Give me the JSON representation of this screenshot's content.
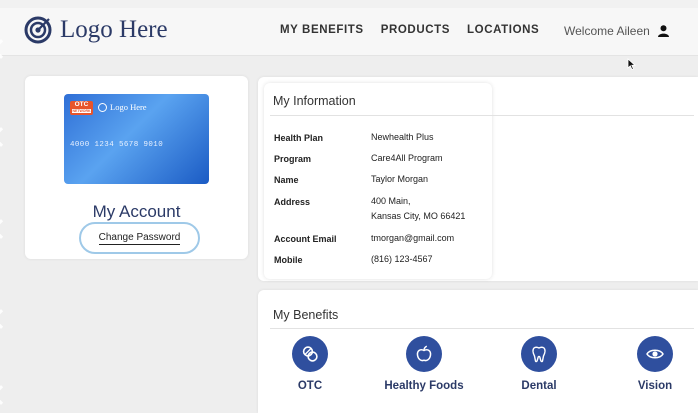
{
  "brand": {
    "logo_text": "Logo Here",
    "color": "#2b3a67",
    "accent": "#2f4f9e"
  },
  "nav": {
    "items": [
      {
        "label": "MY BENEFITS"
      },
      {
        "label": "PRODUCTS"
      },
      {
        "label": "LOCATIONS"
      }
    ]
  },
  "user": {
    "welcome": "Welcome Aileen",
    "icon": "user-icon"
  },
  "account": {
    "card": {
      "badge": "OTC",
      "badge_sub": "NETWORK",
      "logo_text": "Logo Here",
      "number": "4000 1234 5678 9010"
    },
    "title": "My Account",
    "change_password_label": "Change Password"
  },
  "info": {
    "title": "My Information",
    "rows": [
      {
        "label": "Health Plan",
        "value": "Newhealth Plus"
      },
      {
        "label": "Program",
        "value": "Care4All Program"
      },
      {
        "label": "Name",
        "value": "Taylor Morgan"
      },
      {
        "label": "Address",
        "value_line1": "400 Main,",
        "value_line2": "Kansas City, MO 66421"
      },
      {
        "label": "Account Email",
        "value": "tmorgan@gmail.com"
      },
      {
        "label": "Mobile",
        "value": "(816) 123-4567"
      }
    ]
  },
  "benefits": {
    "title": "My Benefits",
    "items": [
      {
        "label": "OTC",
        "icon": "pills-icon"
      },
      {
        "label": "Healthy Foods",
        "icon": "apple-icon"
      },
      {
        "label": "Dental",
        "icon": "tooth-icon"
      },
      {
        "label": "Vision",
        "icon": "eye-icon"
      }
    ]
  }
}
